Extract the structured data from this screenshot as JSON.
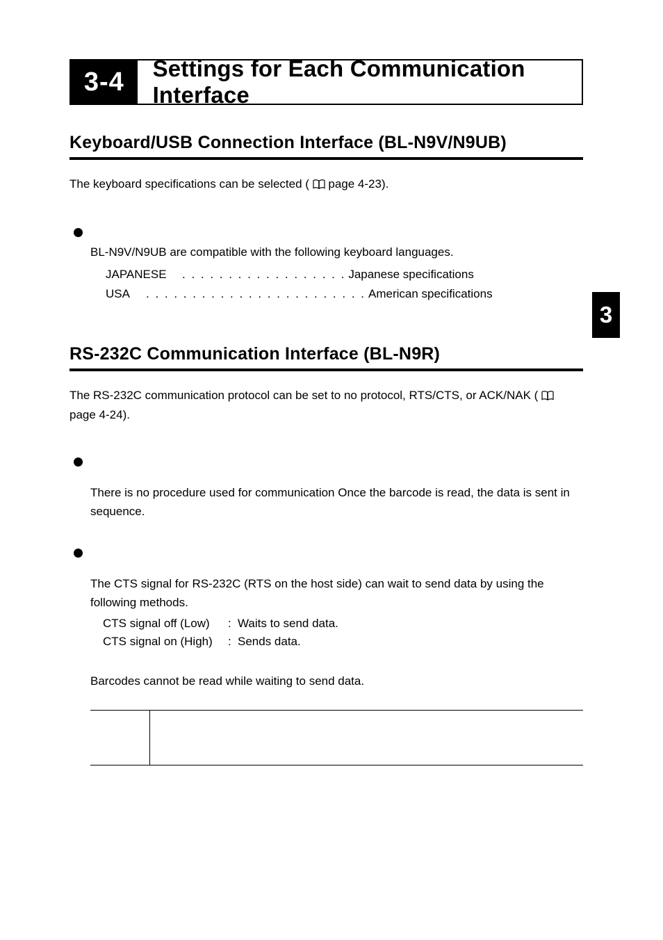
{
  "headline": {
    "number": "3-4",
    "title": "Settings for Each Communication Interface"
  },
  "chapter_tab": "3",
  "section1": {
    "heading": "Keyboard/USB Connection Interface (BL-N9V/N9UB)",
    "lead_a": "The keyboard specifications can be selected (",
    "lead_b": " page 4-23).",
    "bullet_intro": "BL-N9V/N9UB are compatible with the following keyboard languages.",
    "rows": [
      {
        "key": "JAPANESE",
        "dots": ". . . . . . . . . . . . . . . . . .",
        "val": "Japanese specifications"
      },
      {
        "key": "USA",
        "dots": ". . . . . . . . . . . . . . . . . . . . . . . .",
        "val": "American specifications"
      }
    ]
  },
  "section2": {
    "heading": "RS-232C Communication Interface (BL-N9R)",
    "lead_a": "The RS-232C communication protocol can be set to no protocol, RTS/CTS, or ACK/NAK (",
    "lead_b": " page 4-24).",
    "bullet1_text": "There is no procedure used for communication Once the barcode is read, the data is sent in sequence.",
    "bullet2_intro": "The CTS signal for RS-232C (RTS on the host side) can wait to send data by using the following methods.",
    "cts_rows": [
      {
        "a": "CTS signal off (Low)",
        "b": "Waits to send data."
      },
      {
        "a": "CTS signal on (High)",
        "b": "Sends data."
      }
    ],
    "after": "Barcodes cannot be read while waiting to send data."
  }
}
